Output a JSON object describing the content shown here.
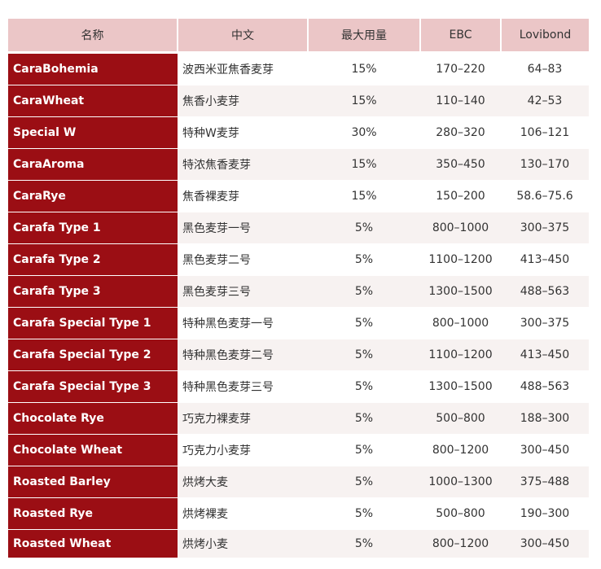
{
  "table": {
    "headers": [
      "名称",
      "中文",
      "最大用量",
      "EBC",
      "Lovibond"
    ],
    "rows": [
      {
        "name": "CaraBohemia",
        "cn": "波西米亚焦香麦芽",
        "max": "15%",
        "ebc": "170–220",
        "lovibond": "64–83"
      },
      {
        "name": "CaraWheat",
        "cn": "焦香小麦芽",
        "max": "15%",
        "ebc": "110–140",
        "lovibond": "42–53"
      },
      {
        "name": "Special W",
        "cn": "特种W麦芽",
        "max": "30%",
        "ebc": "280–320",
        "lovibond": "106–121"
      },
      {
        "name": "CaraAroma",
        "cn": "特浓焦香麦芽",
        "max": "15%",
        "ebc": "350–450",
        "lovibond": "130–170"
      },
      {
        "name": "CaraRye",
        "cn": "焦香裸麦芽",
        "max": "15%",
        "ebc": "150–200",
        "lovibond": "58.6–75.6"
      },
      {
        "name": "Carafa Type 1",
        "cn": "黑色麦芽一号",
        "max": "5%",
        "ebc": "800–1000",
        "lovibond": "300–375"
      },
      {
        "name": "Carafa Type 2",
        "cn": "黑色麦芽二号",
        "max": "5%",
        "ebc": "1100–1200",
        "lovibond": "413–450"
      },
      {
        "name": "Carafa Type 3",
        "cn": "黑色麦芽三号",
        "max": "5%",
        "ebc": "1300–1500",
        "lovibond": "488–563"
      },
      {
        "name": "Carafa Special Type 1",
        "cn": "特种黑色麦芽一号",
        "max": "5%",
        "ebc": "800–1000",
        "lovibond": "300–375"
      },
      {
        "name": "Carafa Special Type 2",
        "cn": "特种黑色麦芽二号",
        "max": "5%",
        "ebc": "1100–1200",
        "lovibond": "413–450"
      },
      {
        "name": "Carafa Special Type 3",
        "cn": "特种黑色麦芽三号",
        "max": "5%",
        "ebc": "1300–1500",
        "lovibond": "488–563"
      },
      {
        "name": "Chocolate Rye",
        "cn": "巧克力裸麦芽",
        "max": "5%",
        "ebc": "500–800",
        "lovibond": "188–300"
      },
      {
        "name": "Chocolate Wheat",
        "cn": "巧克力小麦芽",
        "max": "5%",
        "ebc": "800–1200",
        "lovibond": "300–450"
      },
      {
        "name": "Roasted Barley",
        "cn": "烘烤大麦",
        "max": "5%",
        "ebc": "1000–1300",
        "lovibond": "375–488"
      },
      {
        "name": "Roasted Rye",
        "cn": "烘烤裸麦",
        "max": "5%",
        "ebc": "500–800",
        "lovibond": "190–300"
      },
      {
        "name": "Roasted Wheat",
        "cn": "烘烤小麦",
        "max": "5%",
        "ebc": "800–1200",
        "lovibond": "300–450"
      }
    ]
  },
  "colors": {
    "header_bg": "#ebc6c7",
    "name_col_bg": "#9b0e14",
    "row_alt_bg": "#f7f2f1"
  }
}
